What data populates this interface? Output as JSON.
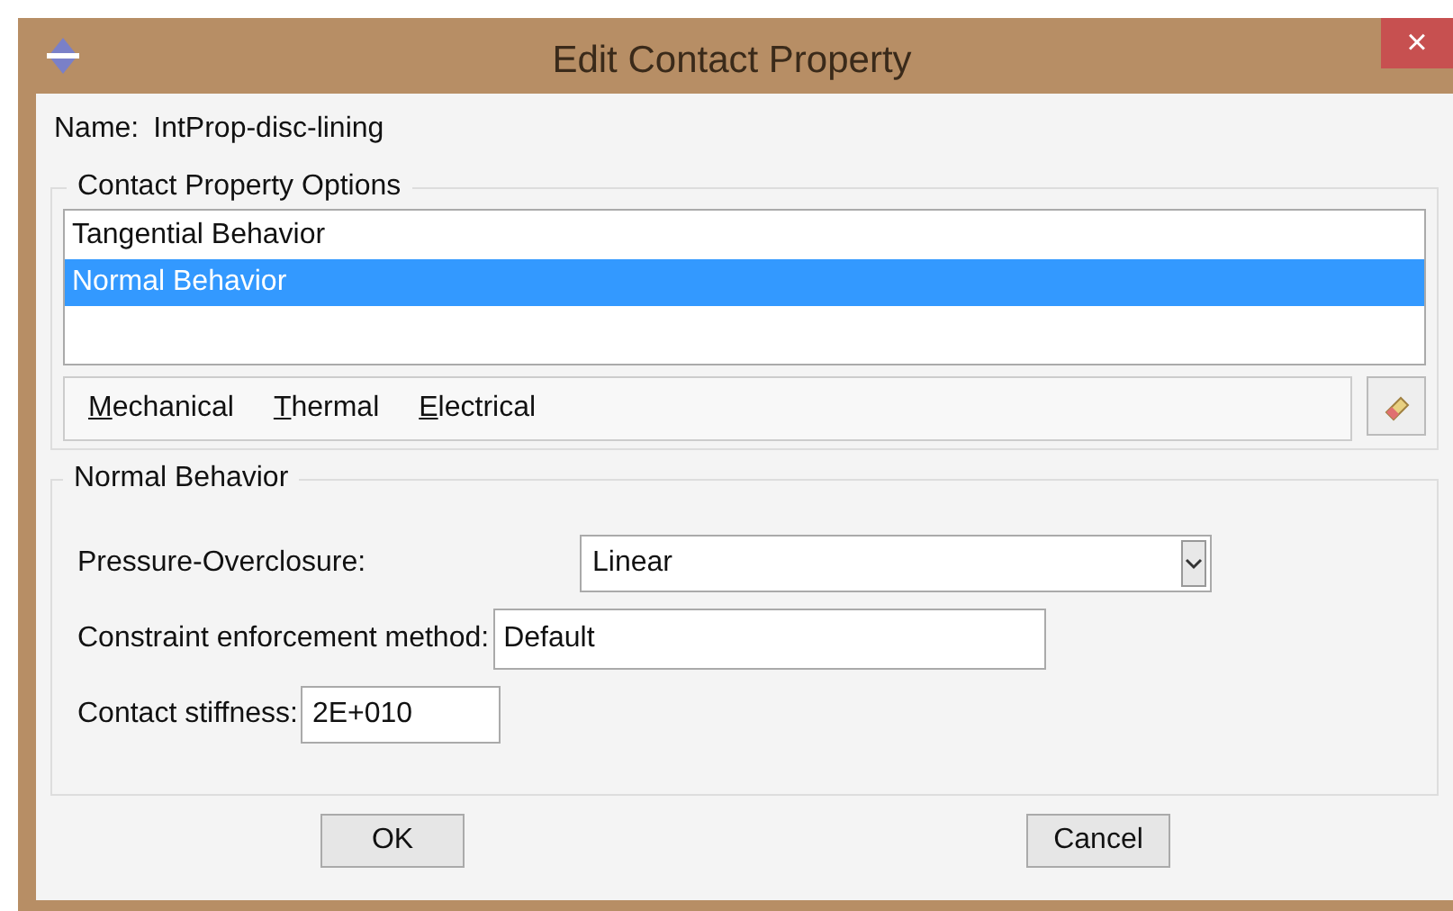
{
  "window": {
    "title": "Edit Contact Property",
    "close": "×"
  },
  "name": {
    "label": "Name:",
    "value": "IntProp-disc-lining"
  },
  "options": {
    "legend": "Contact Property Options",
    "items": [
      {
        "label": "Tangential Behavior",
        "selected": false
      },
      {
        "label": "Normal Behavior",
        "selected": true
      }
    ],
    "menus": [
      "Mechanical",
      "Thermal",
      "Electrical"
    ]
  },
  "behavior": {
    "legend": "Normal Behavior",
    "fields": [
      {
        "kind": "dropdown",
        "label": "Pressure-Overclosure:",
        "value": "Linear"
      },
      {
        "kind": "text",
        "label": "Constraint enforcement method:",
        "value": "Default"
      },
      {
        "kind": "short",
        "label": "Contact stiffness:",
        "value": "2E+010"
      }
    ]
  },
  "buttons": [
    "OK",
    "Cancel"
  ]
}
